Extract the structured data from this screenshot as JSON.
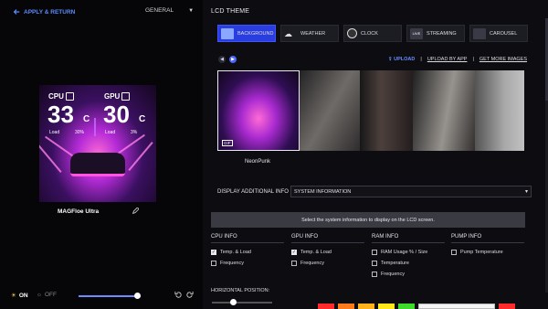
{
  "header": {
    "back_label": "APPLY & RETURN",
    "mode_label": "GENERAL"
  },
  "device": {
    "name": "MAGFloe Ultra"
  },
  "preview": {
    "cpu_label": "CPU",
    "cpu_temp": "33",
    "cpu_unit": "C",
    "cpu_load_label": "Load",
    "cpu_load": "30%",
    "gpu_label": "GPU",
    "gpu_temp": "30",
    "gpu_unit": "C",
    "gpu_load_label": "Load",
    "gpu_load": "3%"
  },
  "power": {
    "on_label": "ON",
    "off_label": "OFF",
    "brightness": 0.95
  },
  "lcd": {
    "title": "LCD THEME",
    "tabs": [
      {
        "label": "BACKGROUND",
        "active": true
      },
      {
        "label": "WEATHER",
        "active": false
      },
      {
        "label": "CLOCK",
        "active": false
      },
      {
        "label": "STREAMING",
        "active": false
      },
      {
        "label": "CAROUSEL",
        "active": false
      }
    ],
    "links": {
      "upload": "UPLOAD",
      "upload_by_app": "UPLOAD BY APP",
      "get_more": "GET MORE IMAGES"
    },
    "selected_thumb_name": "NeonPunk",
    "gif_badge": "GIF"
  },
  "additional_info": {
    "label": "DISPLAY ADDITIONAL INFO",
    "selected": "SYSTEM INFORMATION",
    "hint": "Select the system information to display on the LCD screen."
  },
  "columns": [
    {
      "title": "CPU INFO",
      "items": [
        {
          "label": "Temp. & Load",
          "checked": true
        },
        {
          "label": "Frequency",
          "checked": false
        }
      ]
    },
    {
      "title": "GPU INFO",
      "items": [
        {
          "label": "Temp. & Load",
          "checked": true
        },
        {
          "label": "Frequency",
          "checked": false
        }
      ]
    },
    {
      "title": "RAM INFO",
      "items": [
        {
          "label": "RAM Usage % / Size",
          "checked": false
        },
        {
          "label": "Temperature",
          "checked": false
        },
        {
          "label": "Frequency",
          "checked": false
        }
      ]
    },
    {
      "title": "PUMP INFO",
      "items": [
        {
          "label": "Pump Temperature",
          "checked": false
        }
      ]
    }
  ],
  "horizontal_position": {
    "label": "HORIZONTAL POSITION:"
  },
  "swatch_colors": [
    "#ff2a2a",
    "#ff7a1a",
    "#ffb21a",
    "#ffe81a",
    "#3ddc2a"
  ],
  "colors": {
    "accent": "#4b64ff",
    "link": "#6a8cff"
  }
}
